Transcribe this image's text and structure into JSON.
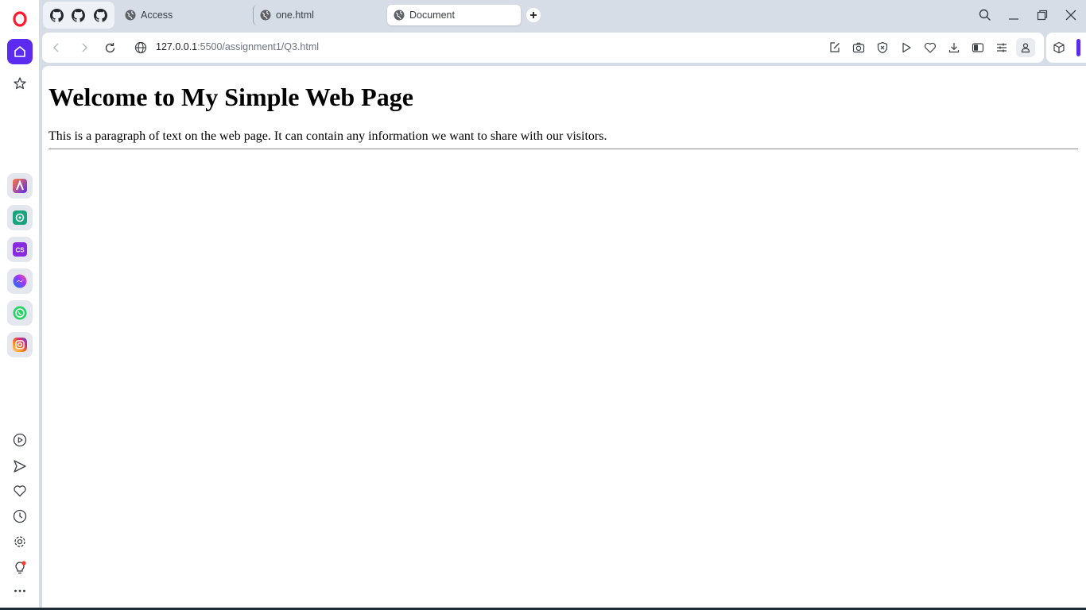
{
  "browser": {
    "tabs": [
      {
        "label": "Access"
      },
      {
        "label": "one.html"
      },
      {
        "label": "Document",
        "active": true
      }
    ],
    "pinned_tabs": [
      "github-icon",
      "github-icon",
      "github-icon"
    ],
    "address": {
      "host": "127.0.0.1",
      "path": ":5500/assignment1/Q3.html"
    },
    "accent_color": "#5b2bf0"
  },
  "sidebar": {
    "apps": [
      "aria-icon",
      "chatgpt-icon",
      "cs-icon",
      "messenger-icon",
      "whatsapp-icon",
      "instagram-icon"
    ],
    "cs_label": "CS",
    "tools": [
      "player-icon",
      "send-icon",
      "heart-icon",
      "history-icon",
      "settings-icon",
      "lightbulb-icon",
      "more-icon"
    ]
  },
  "page": {
    "heading": "Welcome to My Simple Web Page",
    "paragraph": "This is a paragraph of text on the web page. It can contain any information we want to share with our visitors."
  }
}
